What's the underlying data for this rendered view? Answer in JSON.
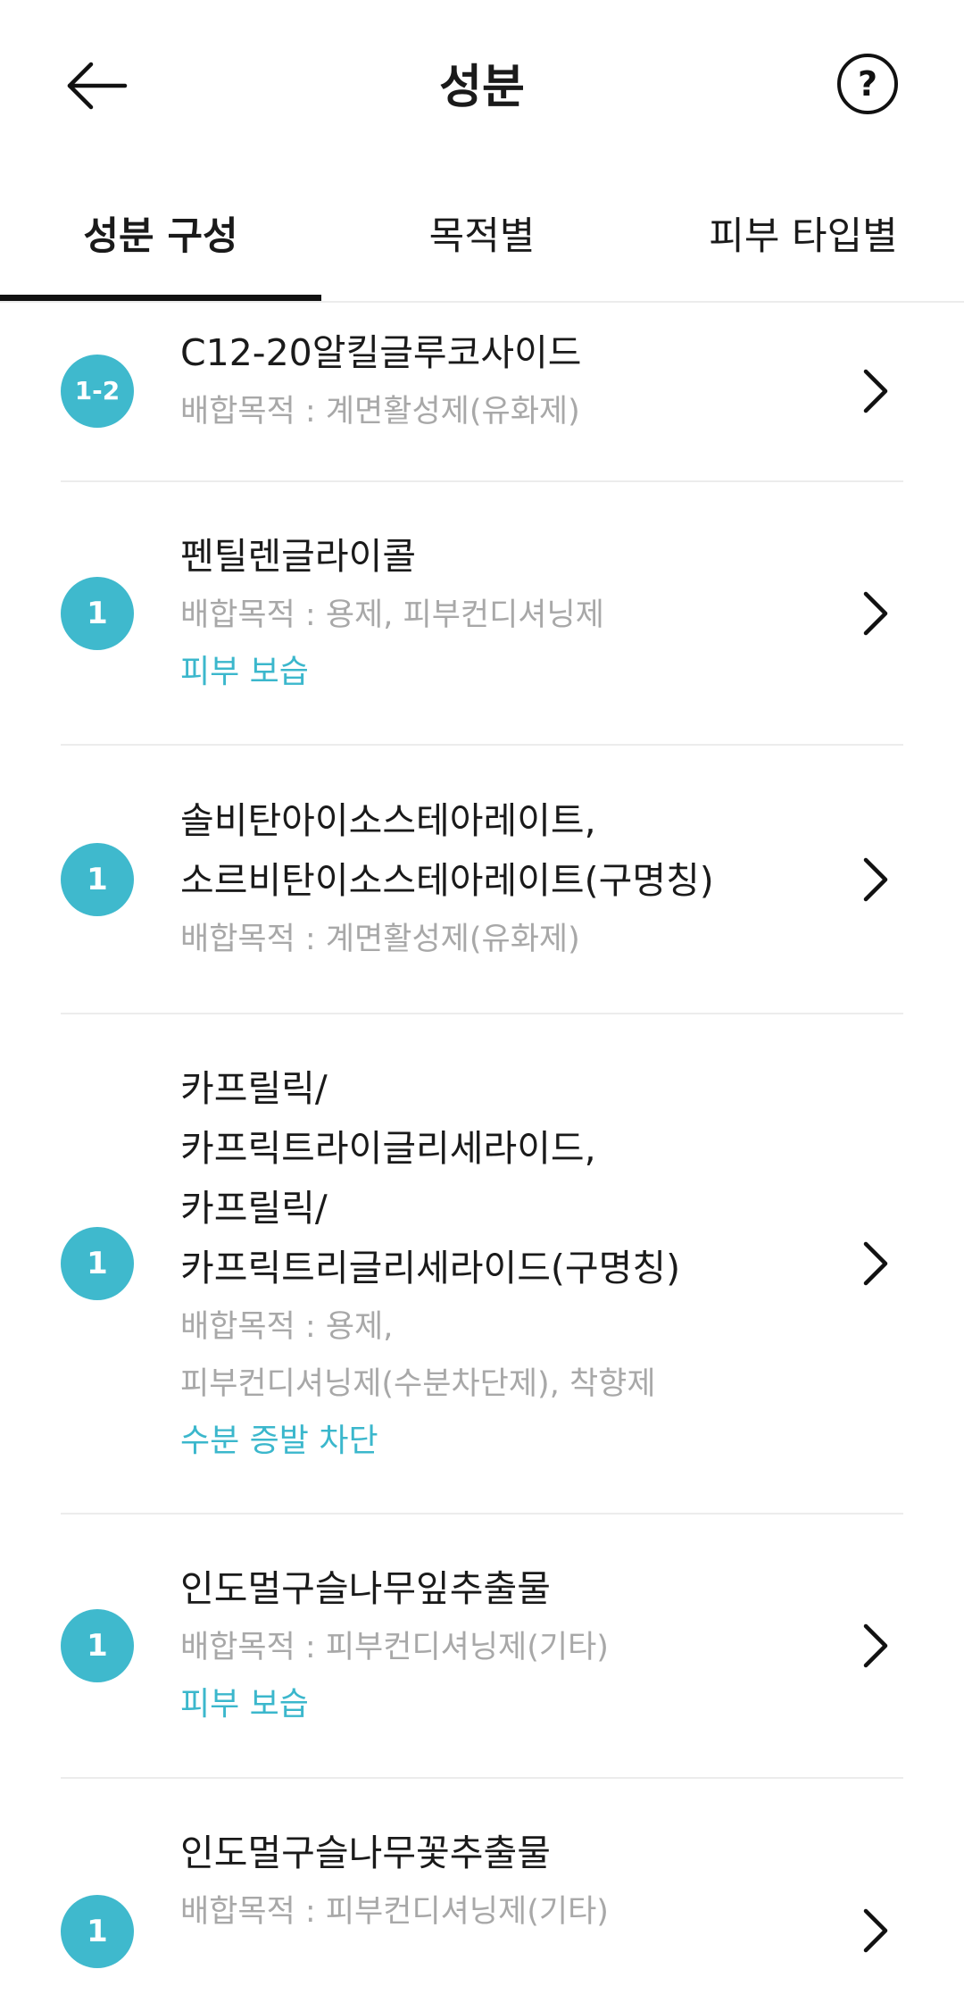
{
  "header": {
    "title": "성분"
  },
  "tabs": [
    {
      "label": "성분 구성",
      "active": true
    },
    {
      "label": "목적별",
      "active": false
    },
    {
      "label": "피부 타입별",
      "active": false
    }
  ],
  "colors": {
    "accent": "#3BB7CC",
    "badge": "#3FB9CD",
    "muted_text": "#A8A8A8"
  },
  "ingredients": [
    {
      "grade": "1-2",
      "name_lines": [
        "C12-20알킬글루코사이드"
      ],
      "purpose_lines": [
        "배합목적 : 계면활성제(유화제)"
      ],
      "tag": ""
    },
    {
      "grade": "1",
      "name_lines": [
        "펜틸렌글라이콜"
      ],
      "purpose_lines": [
        "배합목적 : 용제, 피부컨디셔닝제"
      ],
      "tag": "피부 보습"
    },
    {
      "grade": "1",
      "name_lines": [
        "솔비탄아이소스테아레이트,",
        "소르비탄이소스테아레이트(구명칭)"
      ],
      "purpose_lines": [
        "배합목적 : 계면활성제(유화제)"
      ],
      "tag": ""
    },
    {
      "grade": "1",
      "name_lines": [
        "카프릴릭/",
        "카프릭트라이글리세라이드,",
        "카프릴릭/",
        "카프릭트리글리세라이드(구명칭)"
      ],
      "purpose_lines": [
        "배합목적 : 용제,",
        "피부컨디셔닝제(수분차단제), 착향제"
      ],
      "tag": "수분 증발 차단"
    },
    {
      "grade": "1",
      "name_lines": [
        "인도멀구슬나무잎추출물"
      ],
      "purpose_lines": [
        "배합목적 : 피부컨디셔닝제(기타)"
      ],
      "tag": "피부 보습"
    },
    {
      "grade": "1",
      "name_lines": [
        "인도멀구슬나무꽃추출물"
      ],
      "purpose_lines": [
        "배합목적 : 피부컨디셔닝제(기타)"
      ],
      "tag": ""
    }
  ]
}
